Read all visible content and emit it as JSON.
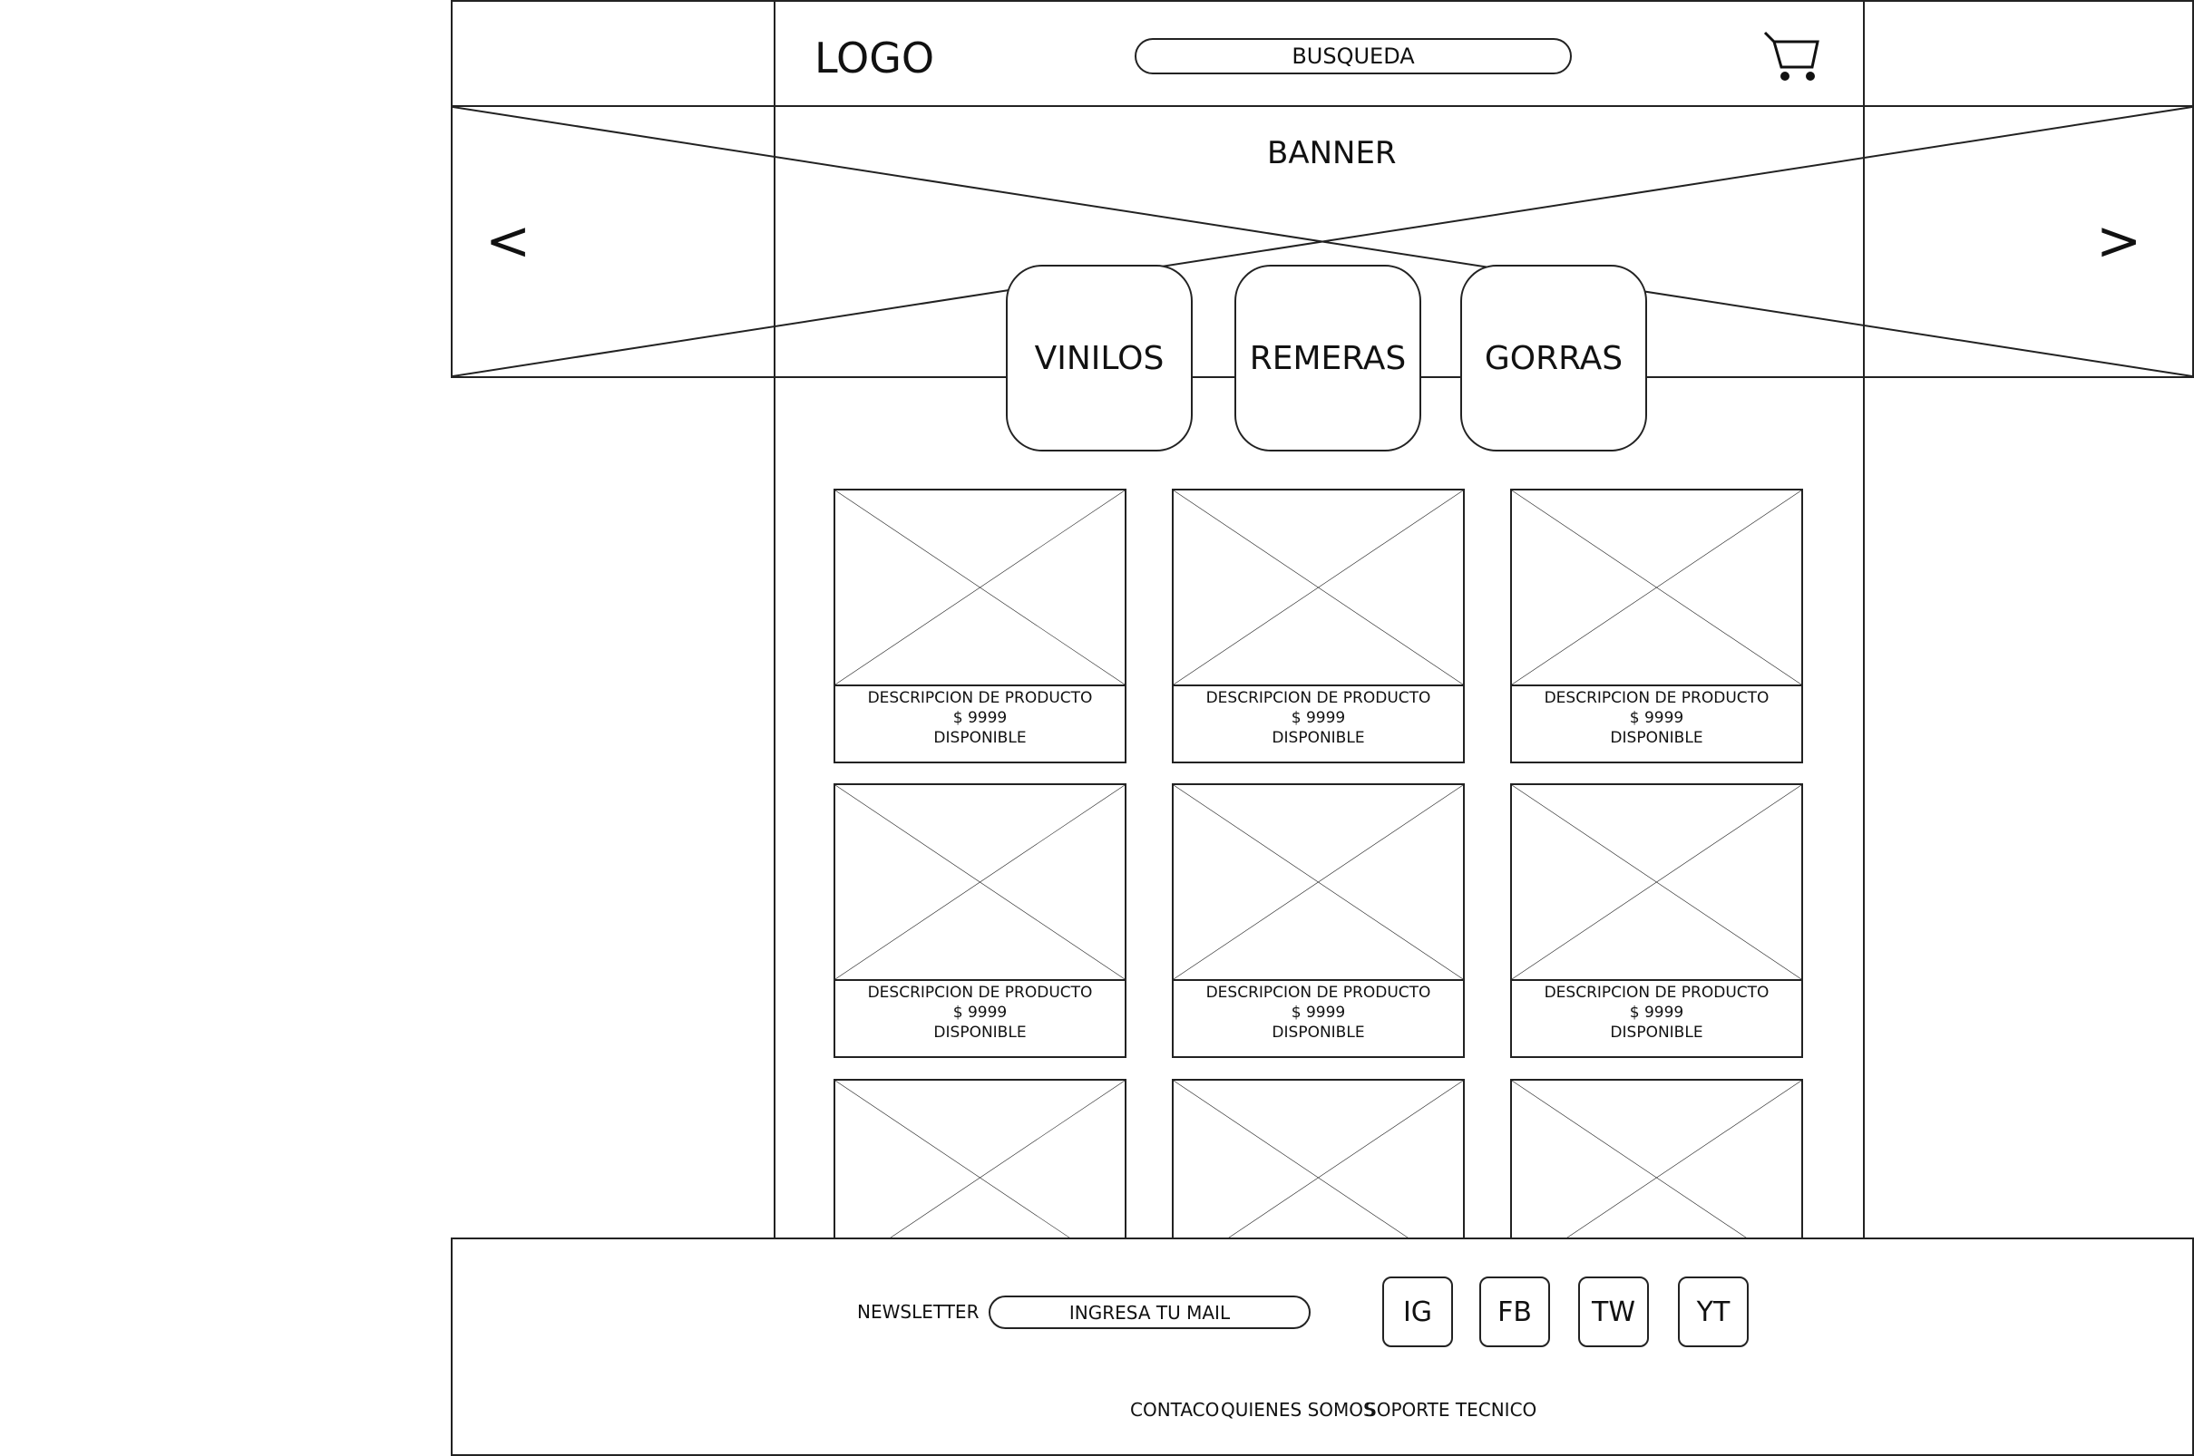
{
  "header": {
    "logo": "LOGO",
    "search_placeholder": "BUSQUEDA",
    "cart_icon": "cart-icon"
  },
  "banner": {
    "label": "BANNER",
    "prev_arrow": "<",
    "next_arrow": ">"
  },
  "categories": [
    {
      "label": "VINILOS"
    },
    {
      "label": "REMERAS"
    },
    {
      "label": "GORRAS"
    }
  ],
  "products": [
    {
      "description": "DESCRIPCION DE PRODUCTO",
      "price": "$ 9999",
      "status": "DISPONIBLE"
    },
    {
      "description": "DESCRIPCION DE PRODUCTO",
      "price": "$ 9999",
      "status": "DISPONIBLE"
    },
    {
      "description": "DESCRIPCION DE PRODUCTO",
      "price": "$ 9999",
      "status": "DISPONIBLE"
    },
    {
      "description": "DESCRIPCION DE PRODUCTO",
      "price": "$ 9999",
      "status": "DISPONIBLE"
    },
    {
      "description": "DESCRIPCION DE PRODUCTO",
      "price": "$ 9999",
      "status": "DISPONIBLE"
    },
    {
      "description": "DESCRIPCION DE PRODUCTO",
      "price": "$ 9999",
      "status": "DISPONIBLE"
    }
  ],
  "footer": {
    "newsletter_label": "NEWSLETTER",
    "email_placeholder": "INGRESA TU MAIL",
    "social": [
      {
        "label": "IG"
      },
      {
        "label": "FB"
      },
      {
        "label": "TW"
      },
      {
        "label": "YT"
      }
    ],
    "links": [
      {
        "label": "CONTACO"
      },
      {
        "label": "QUIENES SOMOS"
      },
      {
        "label": "SOPORTE TECNICO"
      }
    ]
  }
}
